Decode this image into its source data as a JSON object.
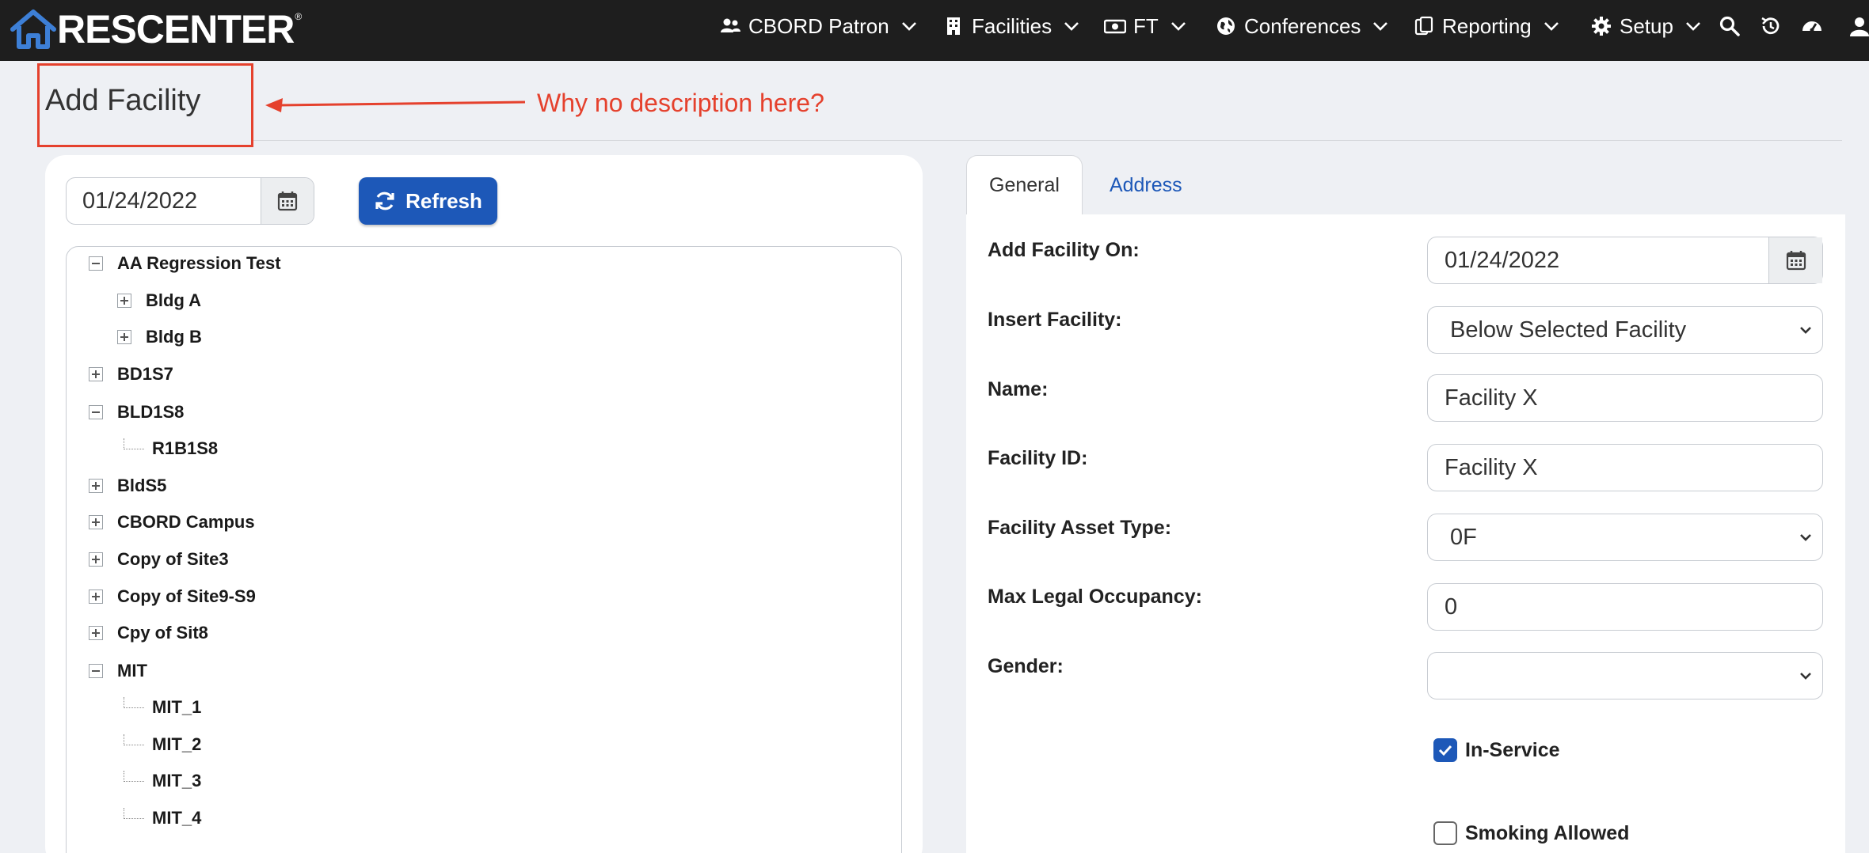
{
  "brand": {
    "name": "RESCENTER",
    "reg": "®"
  },
  "nav": {
    "items": [
      {
        "label": "CBORD Patron",
        "icon": "users-icon"
      },
      {
        "label": "Facilities",
        "icon": "building-icon"
      },
      {
        "label": "FT",
        "icon": "money-icon"
      },
      {
        "label": "Conferences",
        "icon": "globe-icon"
      },
      {
        "label": "Reporting",
        "icon": "clipboard-icon"
      },
      {
        "label": "Setup",
        "icon": "gear-icon"
      }
    ],
    "utility_icons": [
      "search-icon",
      "history-icon",
      "dashboard-icon",
      "user-icon"
    ]
  },
  "page": {
    "title": "Add Facility"
  },
  "annotation": {
    "text": "Why no description here?",
    "color": "#e5412d"
  },
  "left": {
    "date_value": "01/24/2022",
    "refresh_label": "Refresh",
    "tree": [
      {
        "label": "AA Regression Test",
        "level": 0,
        "state": "expanded"
      },
      {
        "label": "Bldg A",
        "level": 1,
        "state": "collapsed"
      },
      {
        "label": "Bldg B",
        "level": 1,
        "state": "collapsed"
      },
      {
        "label": "BD1S7",
        "level": 0,
        "state": "collapsed"
      },
      {
        "label": "BLD1S8",
        "level": 0,
        "state": "expanded"
      },
      {
        "label": "R1B1S8",
        "level": 1,
        "state": "leaf"
      },
      {
        "label": "BldS5",
        "level": 0,
        "state": "collapsed"
      },
      {
        "label": "CBORD Campus",
        "level": 0,
        "state": "collapsed"
      },
      {
        "label": "Copy of Site3",
        "level": 0,
        "state": "collapsed"
      },
      {
        "label": "Copy of Site9-S9",
        "level": 0,
        "state": "collapsed"
      },
      {
        "label": "Cpy of Sit8",
        "level": 0,
        "state": "collapsed"
      },
      {
        "label": "MIT",
        "level": 0,
        "state": "expanded"
      },
      {
        "label": "MIT_1",
        "level": 1,
        "state": "leaf"
      },
      {
        "label": "MIT_2",
        "level": 1,
        "state": "leaf"
      },
      {
        "label": "MIT_3",
        "level": 1,
        "state": "leaf"
      },
      {
        "label": "MIT_4",
        "level": 1,
        "state": "leaf"
      }
    ]
  },
  "tabs": [
    {
      "label": "General",
      "active": true
    },
    {
      "label": "Address",
      "active": false
    }
  ],
  "form": {
    "add_on_label": "Add Facility On:",
    "add_on_value": "01/24/2022",
    "insert_label": "Insert Facility:",
    "insert_value": "Below Selected Facility",
    "name_label": "Name:",
    "name_value": "Facility X",
    "facility_id_label": "Facility ID:",
    "facility_id_value": "Facility X",
    "asset_type_label": "Facility Asset Type:",
    "asset_type_value": "0F",
    "max_occupancy_label": "Max Legal Occupancy:",
    "max_occupancy_value": "0",
    "gender_label": "Gender:",
    "gender_value": "",
    "in_service_label": "In-Service",
    "in_service_checked": true,
    "smoking_label": "Smoking Allowed",
    "smoking_checked": false
  },
  "colors": {
    "nav_bg": "#1e1e1e",
    "accent": "#1d58b8",
    "brand_icon": "#3d7fd6"
  }
}
